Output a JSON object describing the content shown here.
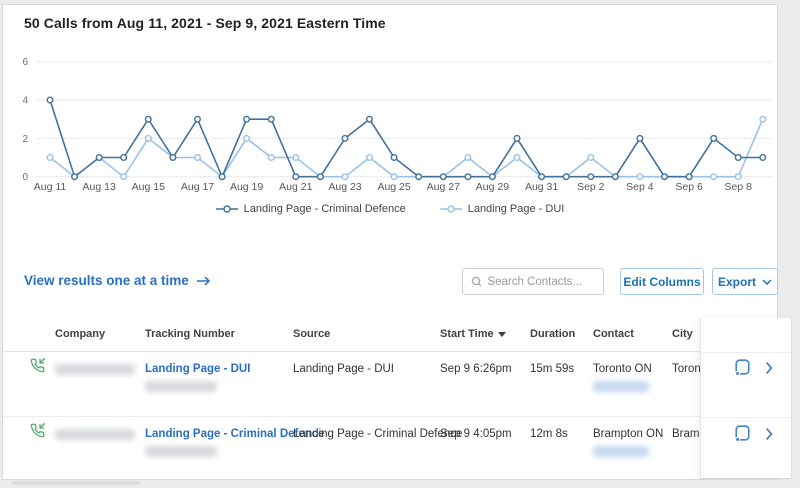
{
  "title": "50 Calls from Aug 11, 2021 - Sep 9, 2021 Eastern Time",
  "chart_data": {
    "type": "line",
    "title": "50 Calls from Aug 11, 2021 - Sep 9, 2021 Eastern Time",
    "categories": [
      "Aug 11",
      "Aug 12",
      "Aug 13",
      "Aug 14",
      "Aug 15",
      "Aug 16",
      "Aug 17",
      "Aug 18",
      "Aug 19",
      "Aug 20",
      "Aug 21",
      "Aug 22",
      "Aug 23",
      "Aug 24",
      "Aug 25",
      "Aug 26",
      "Aug 27",
      "Aug 28",
      "Aug 29",
      "Aug 30",
      "Aug 31",
      "Sep 1",
      "Sep 2",
      "Sep 3",
      "Sep 4",
      "Sep 5",
      "Sep 6",
      "Sep 7",
      "Sep 8",
      "Sep 9"
    ],
    "x_tick_labels": [
      "Aug 11",
      "Aug 13",
      "Aug 15",
      "Aug 17",
      "Aug 19",
      "Aug 21",
      "Aug 23",
      "Aug 25",
      "Aug 27",
      "Aug 29",
      "Aug 31",
      "Sep 2",
      "Sep 4",
      "Sep 6",
      "Sep 8"
    ],
    "y_ticks": [
      0,
      2,
      4,
      6
    ],
    "ylim": [
      0,
      6
    ],
    "grid": true,
    "legend_position": "bottom",
    "series": [
      {
        "name": "Landing Page - Criminal Defence",
        "color": "#41719e",
        "values": [
          4,
          0,
          1,
          1,
          3,
          1,
          3,
          0,
          3,
          3,
          0,
          0,
          2,
          3,
          1,
          0,
          0,
          0,
          0,
          2,
          0,
          0,
          0,
          0,
          2,
          0,
          0,
          2,
          1,
          1
        ]
      },
      {
        "name": "Landing Page - DUI",
        "color": "#9ac2e8",
        "values": [
          1,
          0,
          1,
          0,
          2,
          1,
          1,
          0,
          2,
          1,
          1,
          0,
          0,
          1,
          0,
          0,
          0,
          1,
          0,
          1,
          0,
          0,
          1,
          0,
          0,
          0,
          0,
          0,
          0,
          3
        ]
      }
    ]
  },
  "toolbar": {
    "view_results_link": "View results one at a time",
    "search_placeholder": "Search Contacts...",
    "edit_columns_label": "Edit Columns",
    "export_label": "Export"
  },
  "table": {
    "columns": [
      "Company",
      "Tracking Number",
      "Source",
      "Start Time",
      "Duration",
      "Contact",
      "City"
    ],
    "sorted_column": "Start Time",
    "rows": [
      {
        "tracking_number": "Landing Page - DUI",
        "source": "Landing Page - DUI",
        "start_time": "Sep 9 6:26pm",
        "duration": "15m 59s",
        "contact": "Toronto ON",
        "city": "Toronto"
      },
      {
        "tracking_number": "Landing Page - Criminal Defence",
        "source": "Landing Page - Criminal Defence",
        "start_time": "Sep 9 4:05pm",
        "duration": "12m 8s",
        "contact": "Brampton ON",
        "city": "Brampton"
      }
    ]
  },
  "colors": {
    "link_blue": "#2a6fc4",
    "button_blue": "#1d71b8",
    "series_dark": "#41719e",
    "series_light": "#9ac2e8",
    "phone_green": "#48ab66",
    "action_blue": "#4285c9"
  }
}
